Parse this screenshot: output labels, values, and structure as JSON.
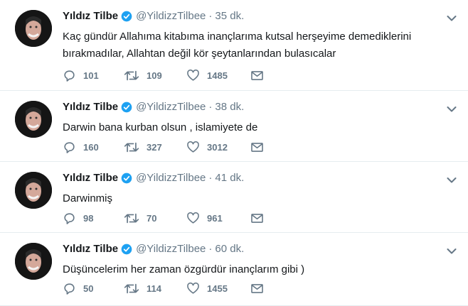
{
  "colors": {
    "verified": "#1da1f2",
    "muted": "#657786",
    "text": "#14171a",
    "border": "#e6ecf0"
  },
  "tweets": [
    {
      "name": "Yıldız Tilbe",
      "handle": "@YildizzTilbee",
      "dot": "·",
      "time": "35 dk.",
      "text": "Kaç gündür Allahıma kitabıma inançlarıma kutsal herşeyime demediklerini bırakmadılar, Allahtan değil kör şeytanlarından bulasıcalar",
      "replies": "101",
      "retweets": "109",
      "likes": "1485"
    },
    {
      "name": "Yıldız Tilbe",
      "handle": "@YildizzTilbee",
      "dot": "·",
      "time": "38 dk.",
      "text": "Darwin bana kurban olsun , islamiyete de",
      "replies": "160",
      "retweets": "327",
      "likes": "3012"
    },
    {
      "name": "Yıldız Tilbe",
      "handle": "@YildizzTilbee",
      "dot": "·",
      "time": "41 dk.",
      "text": "Darwinmiş",
      "replies": "98",
      "retweets": "70",
      "likes": "961"
    },
    {
      "name": "Yıldız Tilbe",
      "handle": "@YildizzTilbee",
      "dot": "·",
      "time": "60 dk.",
      "text": "Düşüncelerim her zaman özgürdür inançlarım gibi )",
      "replies": "50",
      "retweets": "114",
      "likes": "1455"
    }
  ]
}
